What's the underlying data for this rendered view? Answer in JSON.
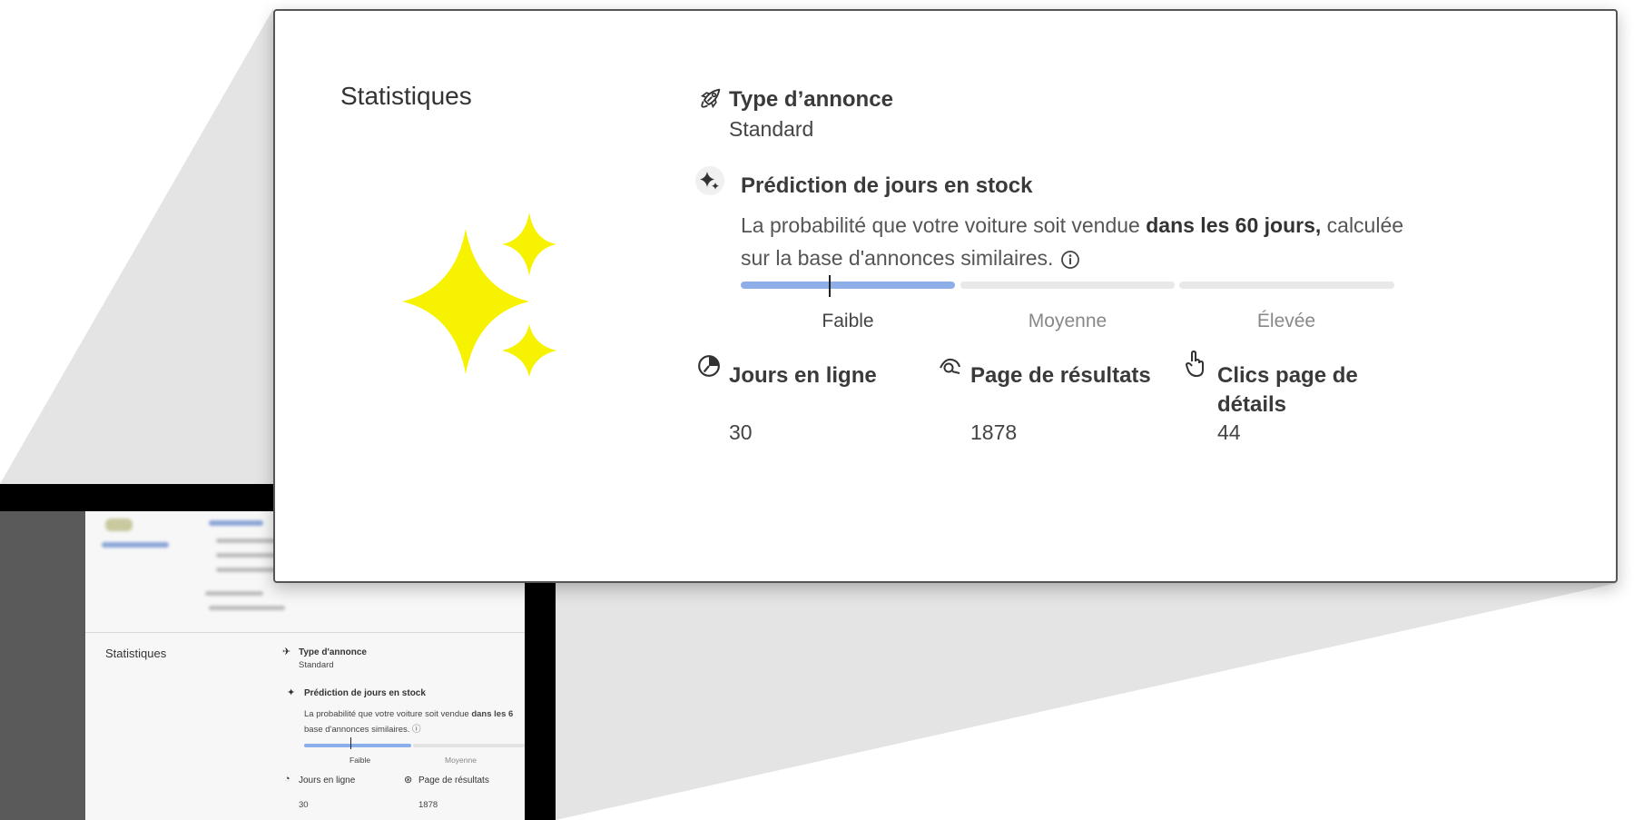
{
  "card": {
    "title": "Statistiques",
    "ad_type": {
      "label": "Type d’annonce",
      "value": "Standard",
      "icon": "rocket-icon"
    },
    "prediction": {
      "label": "Prédiction de jours en stock",
      "icon": "sparkle-icon",
      "description_before": "La probabilité que votre voiture soit vendue ",
      "description_bold": "dans les 60 jours,",
      "description_after": " calculée sur la base d'annonces similaires.",
      "levels": [
        "Faible",
        "Moyenne",
        "Élevée"
      ],
      "active_level": "Faible",
      "fill_fraction": 0.33,
      "marker_fraction": 0.135
    },
    "metrics": [
      {
        "label": "Jours en ligne",
        "value": "30",
        "icon": "clock-icon"
      },
      {
        "label": "Page de résultats",
        "value": "1878",
        "icon": "eye-icon"
      },
      {
        "label_line1": "Clics page de",
        "label_line2": "détails",
        "value": "44",
        "icon": "tap-icon"
      }
    ]
  },
  "mini": {
    "title": "Statistiques",
    "ad_type_label": "Type d'annonce",
    "ad_type_value": "Standard",
    "prediction_label": "Prédiction de jours en stock",
    "desc_line1_before": "La probabilité que votre voiture soit vendue ",
    "desc_line1_bold": "dans les 6",
    "desc_line2": "base d'annonces similaires.",
    "level_low": "Faible",
    "level_mid": "Moyenne",
    "metric1": "Jours en ligne",
    "metric2": "Page de résultats",
    "metric1_value": "30",
    "metric2_value": "1878"
  },
  "colors": {
    "sparkle": "#f7f200",
    "bar_fill": "#8eaee8",
    "bar_empty": "#e8e8e8"
  }
}
